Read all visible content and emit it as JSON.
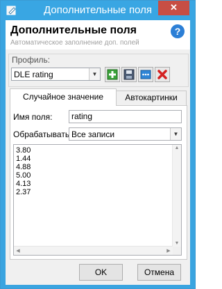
{
  "window": {
    "title": "Дополнительные поля",
    "close_symbol": "✕",
    "accent": "#3aa4e0"
  },
  "header": {
    "title": "Дополнительные поля",
    "subtitle": "Автоматическое заполнение доп. полей",
    "help_icon": "help-icon"
  },
  "profile": {
    "label": "Профиль:",
    "selected": "DLE rating",
    "buttons": [
      {
        "icon": "add-icon"
      },
      {
        "icon": "save-icon"
      },
      {
        "icon": "more-icon"
      },
      {
        "icon": "delete-icon"
      }
    ]
  },
  "tabs": [
    {
      "label": "Случайное значение",
      "active": true
    },
    {
      "label": "Автокартинки",
      "active": false
    }
  ],
  "form": {
    "field_name_label": "Имя поля:",
    "field_name_value": "rating",
    "process_label": "Обрабатывать:",
    "process_value": "Все записи"
  },
  "values": [
    "3.80",
    "1.44",
    "4.88",
    "5.00",
    "4.13",
    "2.37"
  ],
  "footer": {
    "ok_label": "OK",
    "cancel_label": "Отмена"
  }
}
